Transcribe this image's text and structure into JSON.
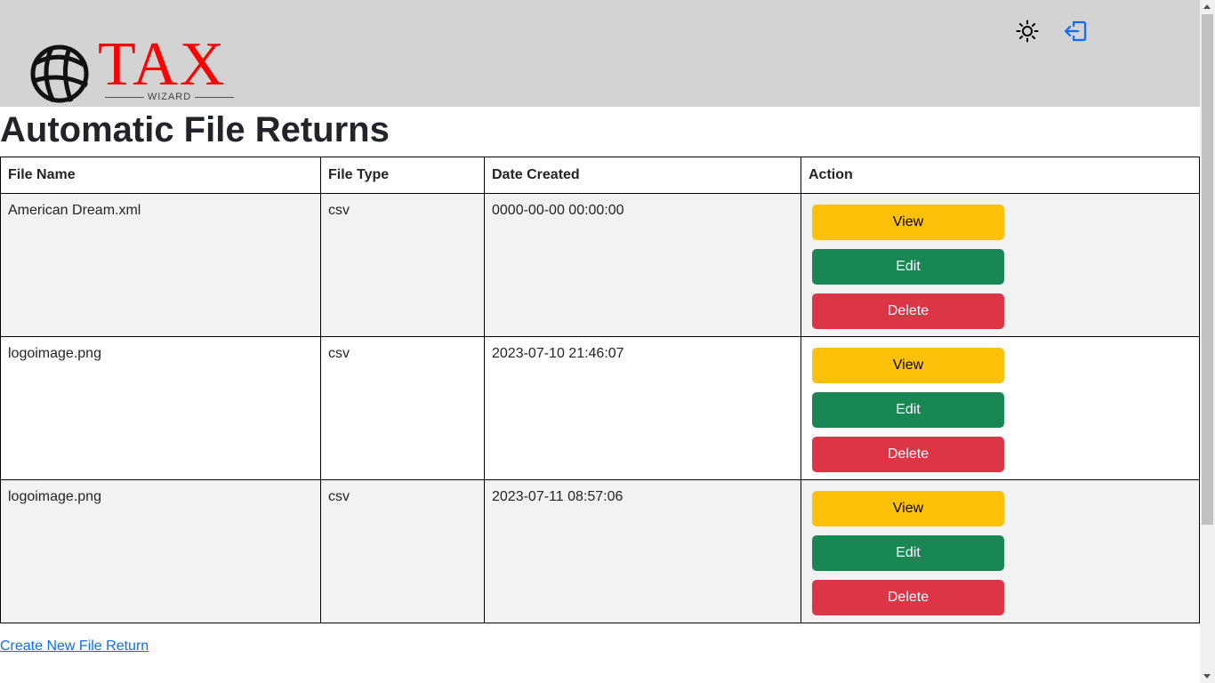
{
  "header": {
    "logo_text": "TAX",
    "logo_subtext": "WIZARD",
    "icons": [
      "sun-icon",
      "logout-icon"
    ]
  },
  "page_title": "Automatic File Returns",
  "table": {
    "headers": [
      "File Name",
      "File Type",
      "Date Created",
      "Action"
    ],
    "rows": [
      {
        "file_name": "American Dream.xml",
        "file_type": "csv",
        "date_created": "0000-00-00 00:00:00"
      },
      {
        "file_name": "logoimage.png",
        "file_type": "csv",
        "date_created": "2023-07-10 21:46:07"
      },
      {
        "file_name": "logoimage.png",
        "file_type": "csv",
        "date_created": "2023-07-11 08:57:06"
      }
    ],
    "actions": {
      "view": "View",
      "edit": "Edit",
      "delete": "Delete"
    }
  },
  "create_link": "Create New File Return",
  "colors": {
    "header_bg": "#d3d3d3",
    "logo_red": "#ff0000",
    "view": "#ffc107",
    "edit": "#198754",
    "delete": "#dc3545",
    "link": "#0d6efd",
    "logout_icon": "#0d6efd"
  }
}
